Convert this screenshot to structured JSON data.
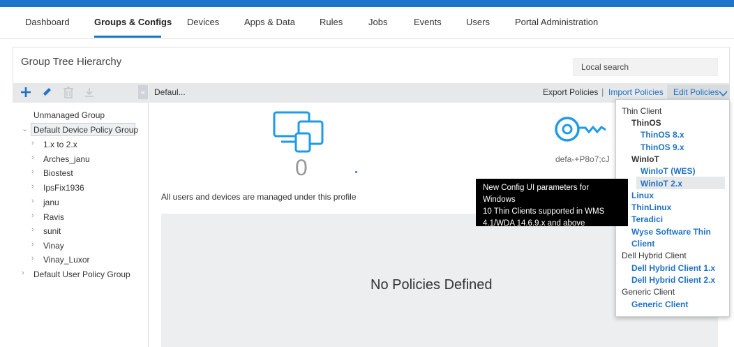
{
  "nav": {
    "items": [
      {
        "label": "Dashboard"
      },
      {
        "label": "Groups & Configs"
      },
      {
        "label": "Devices"
      },
      {
        "label": "Apps & Data"
      },
      {
        "label": "Rules"
      },
      {
        "label": "Jobs"
      },
      {
        "label": "Events"
      },
      {
        "label": "Users"
      },
      {
        "label": "Portal Administration"
      }
    ],
    "active": "Groups & Configs"
  },
  "page": {
    "title": "Group Tree Hierarchy",
    "search_value": "Local search"
  },
  "toolbar": {
    "icons": [
      "add-icon",
      "edit-icon",
      "delete-icon",
      "download-icon"
    ],
    "collapse_label": "«"
  },
  "tree": {
    "root_items": [
      {
        "label": "Unmanaged Group"
      },
      {
        "label": "Default Device Policy Group"
      },
      {
        "label": "1.x to 2.x"
      },
      {
        "label": "Arches_janu"
      },
      {
        "label": "Biostest"
      },
      {
        "label": "IpsFix1936"
      },
      {
        "label": "janu"
      },
      {
        "label": "Ravis"
      },
      {
        "label": "sunit"
      },
      {
        "label": "Vinay"
      },
      {
        "label": "Vinay_Luxor"
      },
      {
        "label": "Default User Policy Group"
      }
    ],
    "chevron_right": "›",
    "chevron_down": "⌄"
  },
  "content": {
    "breadcrumb": "Defaul...",
    "export_label": "Export Policies",
    "import_label": "Import Policies",
    "edit_label": "Edit Policies",
    "separator": "|",
    "device_count": "0",
    "key_text": "defa-+P8o7;cJ",
    "profile_text": "All users and devices are managed under this profile",
    "no_policies": "No Policies Defined"
  },
  "dropdown": {
    "items": [
      {
        "label": "Thin Client"
      },
      {
        "label": "ThinOS"
      },
      {
        "label": "ThinOS 8.x"
      },
      {
        "label": "ThinOS 9.x"
      },
      {
        "label": "WinIoT"
      },
      {
        "label": "WinIoT (WES)"
      },
      {
        "label": "WinIoT 2.x"
      },
      {
        "label": "Linux"
      },
      {
        "label": "ThinLinux"
      },
      {
        "label": "Teradici"
      },
      {
        "label": "Wyse Software Thin"
      },
      {
        "label": "Client"
      },
      {
        "label": "Dell Hybrid Client"
      },
      {
        "label": "Dell Hybrid Client 1.x"
      },
      {
        "label": "Dell Hybrid Client 2.x"
      },
      {
        "label": "Generic Client"
      },
      {
        "label": "Generic Client"
      }
    ]
  },
  "tooltip": {
    "line1": "New Config UI parameters for Windows",
    "line2": "10 Thin Clients supported in WMS",
    "line3": "4.1/WDA 14.6.9.x and above"
  },
  "colors": {
    "accent": "#1e74c9",
    "link": "#1f72c4"
  }
}
